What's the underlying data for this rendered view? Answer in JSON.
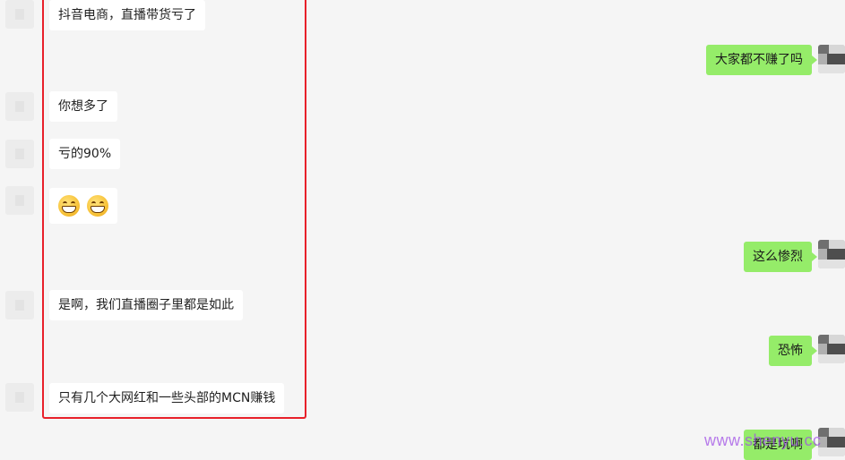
{
  "messages_left": [
    {
      "text": "抖音电商，直播带货亏了"
    },
    {
      "text": "你想多了"
    },
    {
      "text": "亏的90%"
    },
    {
      "emoji": [
        "grin-emoji",
        "grin-emoji"
      ]
    },
    {
      "text": "是啊，我们直播圈子里都是如此"
    },
    {
      "text": "只有几个大网红和一些头部的MCN赚钱"
    }
  ],
  "messages_right": [
    {
      "text": "大家都不赚了吗"
    },
    {
      "text": "这么惨烈"
    },
    {
      "text": "恐怖"
    },
    {
      "text": "都是坑啊"
    }
  ],
  "highlight_color": "#e8202a",
  "bubble_color_self": "#95ec69",
  "bubble_color_other": "#ffffff",
  "watermark": "www.shenyu.cc"
}
